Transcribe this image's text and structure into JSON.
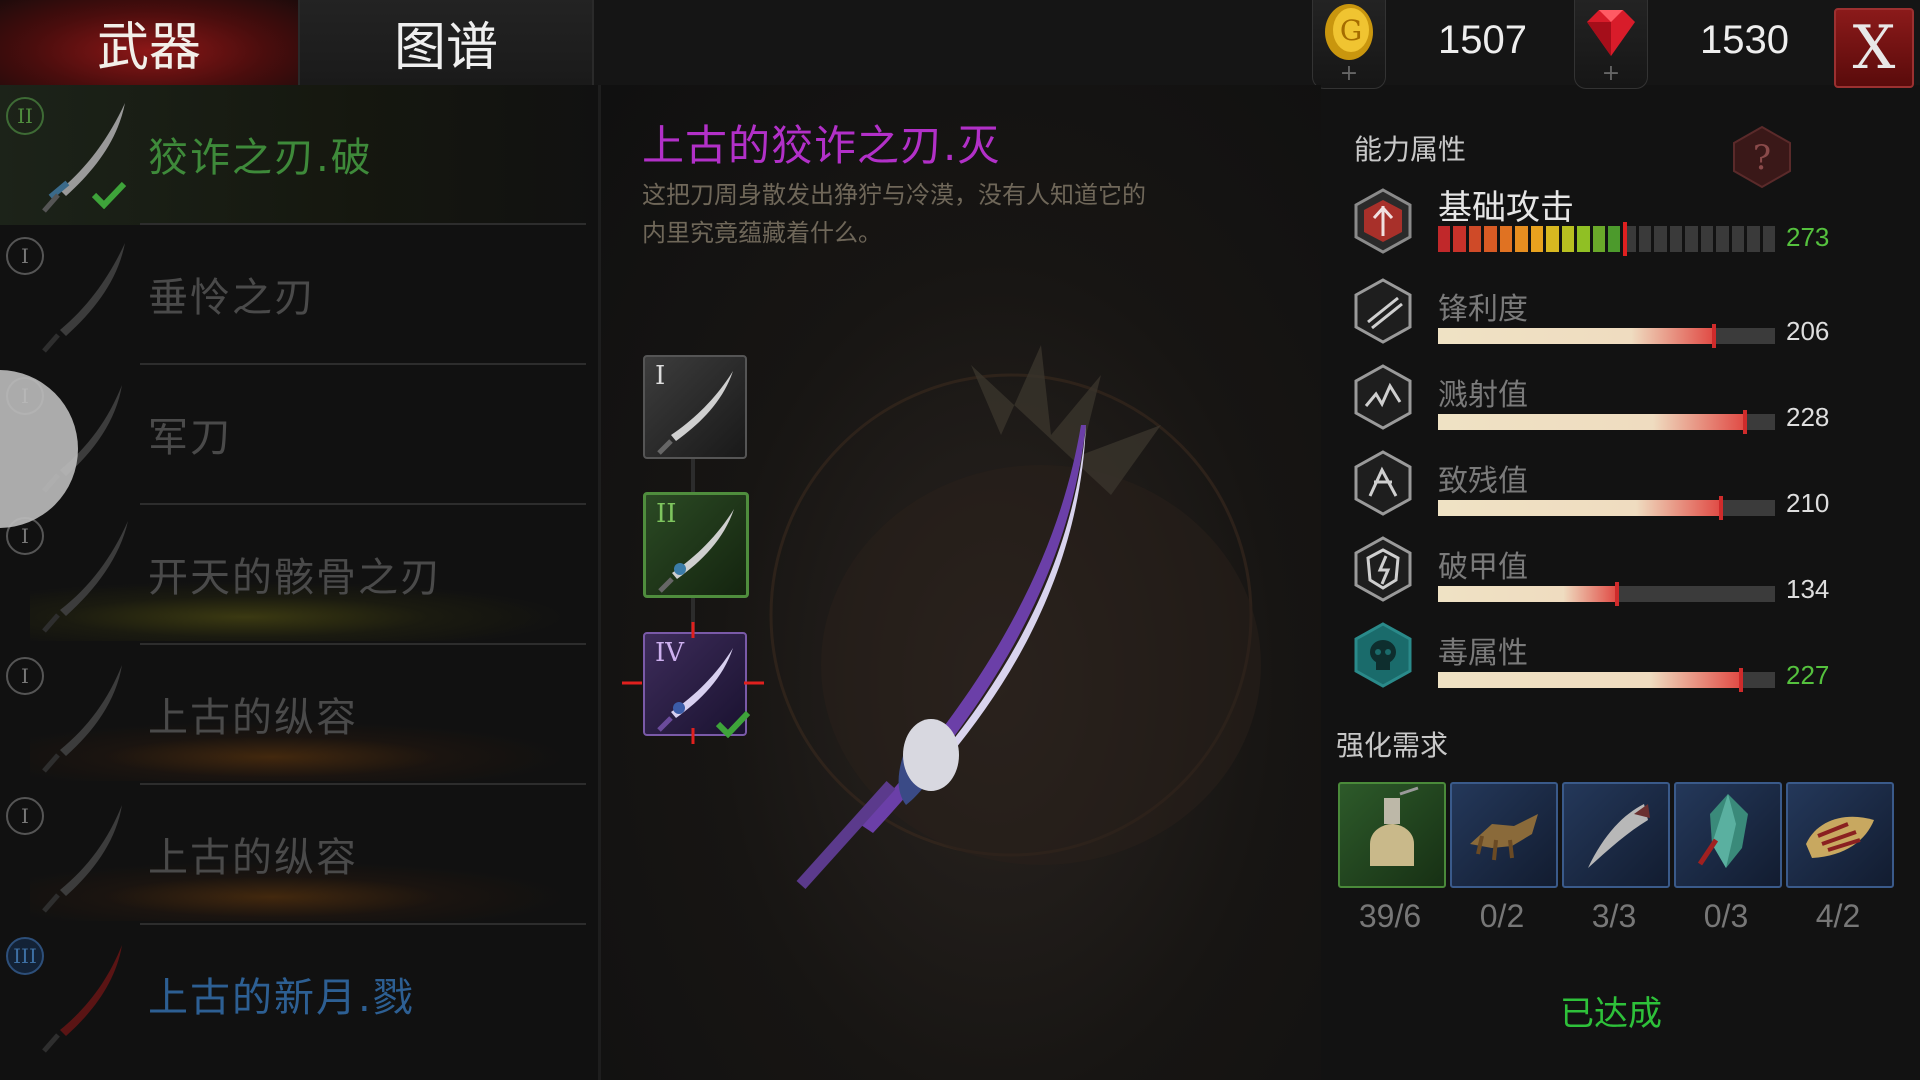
{
  "tabs": {
    "weapon": "武器",
    "codex": "图谱"
  },
  "currency": {
    "gold": "1507",
    "gems": "1530"
  },
  "close_label": "X",
  "weapon_list": [
    {
      "tier": "II",
      "name": "狡诈之刃.破",
      "state": "selected"
    },
    {
      "tier": "I",
      "name": "垂怜之刃",
      "state": "locked"
    },
    {
      "tier": "I",
      "name": "军刀",
      "state": "locked"
    },
    {
      "tier": "I",
      "name": "开天的骸骨之刃",
      "state": "locked"
    },
    {
      "tier": "I",
      "name": "上古的纵容",
      "state": "locked"
    },
    {
      "tier": "I",
      "name": "上古的纵容",
      "state": "locked"
    },
    {
      "tier": "III",
      "name": "上古的新月.戮",
      "state": "locked"
    }
  ],
  "detail": {
    "title": "上古的狡诈之刃.灭",
    "description_line1": "这把刀周身散发出狰狞与冷漠，没有人知道它的",
    "description_line2": "内里究竟蕴藏着什么。",
    "tiers": [
      {
        "roman": "I",
        "state": "owned"
      },
      {
        "roman": "II",
        "state": "owned"
      },
      {
        "roman": "IV",
        "state": "current"
      }
    ]
  },
  "stats": {
    "title": "能力属性",
    "items": [
      {
        "name": "基础攻击",
        "value": "273",
        "icon": "attack-shield-icon",
        "green": true,
        "fraction": 0.55
      },
      {
        "name": "锋利度",
        "value": "206",
        "icon": "sharpness-icon",
        "green": false,
        "fraction": 0.82
      },
      {
        "name": "溅射值",
        "value": "228",
        "icon": "splash-icon",
        "green": false,
        "fraction": 0.91
      },
      {
        "name": "致残值",
        "value": "210",
        "icon": "cripple-icon",
        "green": false,
        "fraction": 0.84
      },
      {
        "name": "破甲值",
        "value": "134",
        "icon": "armor-break-icon",
        "green": false,
        "fraction": 0.53
      },
      {
        "name": "毒属性",
        "value": "227",
        "icon": "poison-skull-icon",
        "green": true,
        "fraction": 0.9
      }
    ]
  },
  "upgrade": {
    "title": "强化需求",
    "materials": [
      {
        "icon": "potion-flask-icon",
        "count": "39/6",
        "frame": "green"
      },
      {
        "icon": "bone-claw-icon",
        "count": "0/2",
        "frame": "blue"
      },
      {
        "icon": "fang-icon",
        "count": "3/3",
        "frame": "blue"
      },
      {
        "icon": "crystal-shard-icon",
        "count": "0/3",
        "frame": "blue"
      },
      {
        "icon": "gold-spine-icon",
        "count": "4/2",
        "frame": "blue"
      }
    ],
    "status": "已达成"
  },
  "colors": {
    "accent_purple": "#b230c8",
    "achieved_green": "#2ec13a",
    "selected_green": "#3e8a3a"
  }
}
